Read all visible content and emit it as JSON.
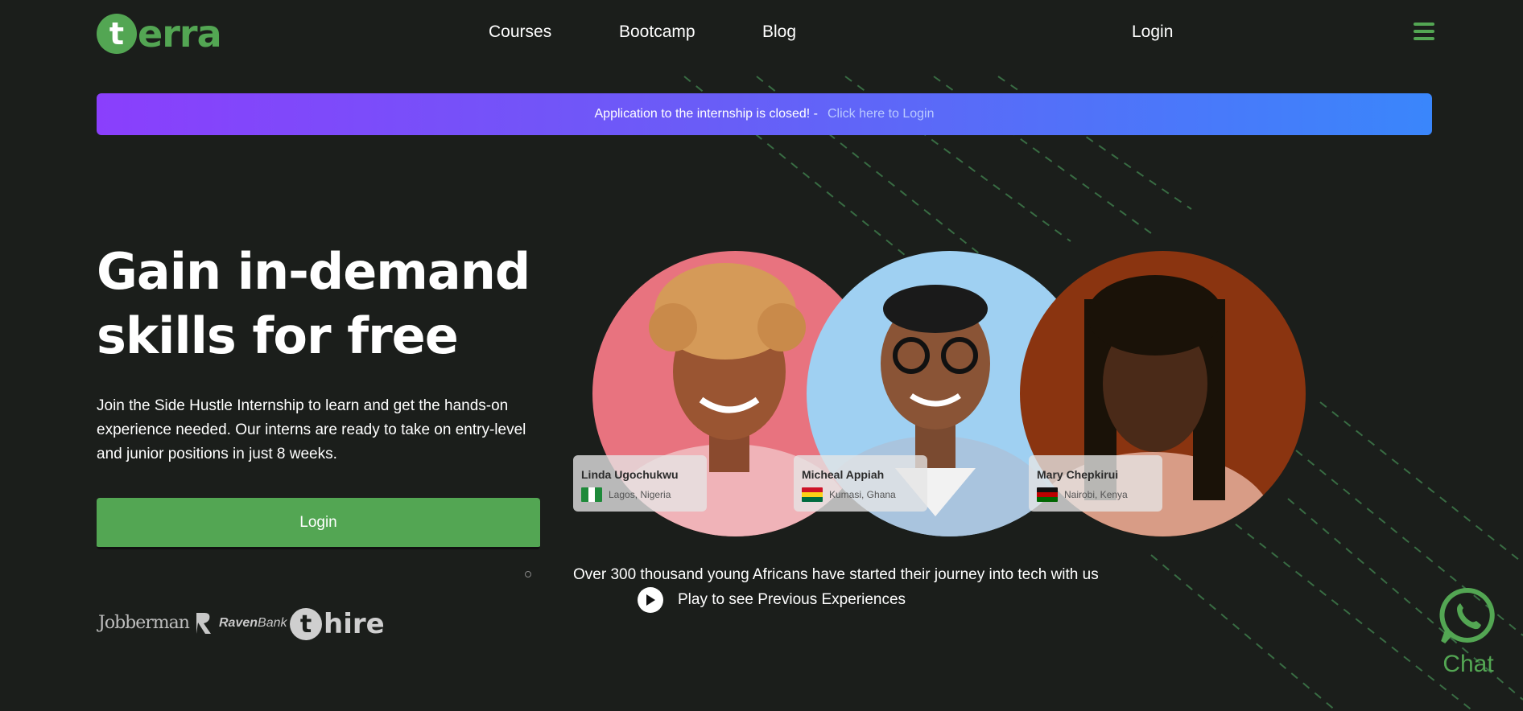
{
  "brand": {
    "logo_mark": "t",
    "logo_text": "erra",
    "accent_color": "#53a653"
  },
  "nav": {
    "links": [
      "Courses",
      "Bootcamp",
      "Blog"
    ],
    "login_label": "Login",
    "menu_icon": "hamburger-icon"
  },
  "banner": {
    "message": "Application to the internship is closed! -",
    "link_text": "Click here to Login",
    "gradient": [
      "#8a3ffc",
      "#3a86fb"
    ]
  },
  "hero": {
    "title_line1": "Gain in-demand",
    "title_line2": "skills for free",
    "description": "Join the Side Hustle Internship to learn and get the hands-on experience needed. Our interns are ready to take on entry-level and junior positions in just 8 weeks.",
    "login_button": "Login"
  },
  "partners": {
    "jobberman": "Jobberman",
    "ravenbank_bold": "Raven",
    "ravenbank_rest": "Bank",
    "thire_mark": "t",
    "thire_text": "hire"
  },
  "people": [
    {
      "name": "Linda Ugochukwu",
      "location": "Lagos, Nigeria",
      "flag": "nigeria-flag-icon"
    },
    {
      "name": "Micheal Appiah",
      "location": "Kumasi, Ghana",
      "flag": "ghana-flag-icon"
    },
    {
      "name": "Mary Chepkirui",
      "location": "Nairobi, Kenya",
      "flag": "kenya-flag-icon"
    }
  ],
  "journey_text": "Over 300 thousand young Africans have started their journey into tech with us",
  "play": {
    "label": "Play to see Previous Experiences",
    "icon": "play-icon"
  },
  "chat": {
    "label": "Chat",
    "icon": "whatsapp-icon"
  }
}
